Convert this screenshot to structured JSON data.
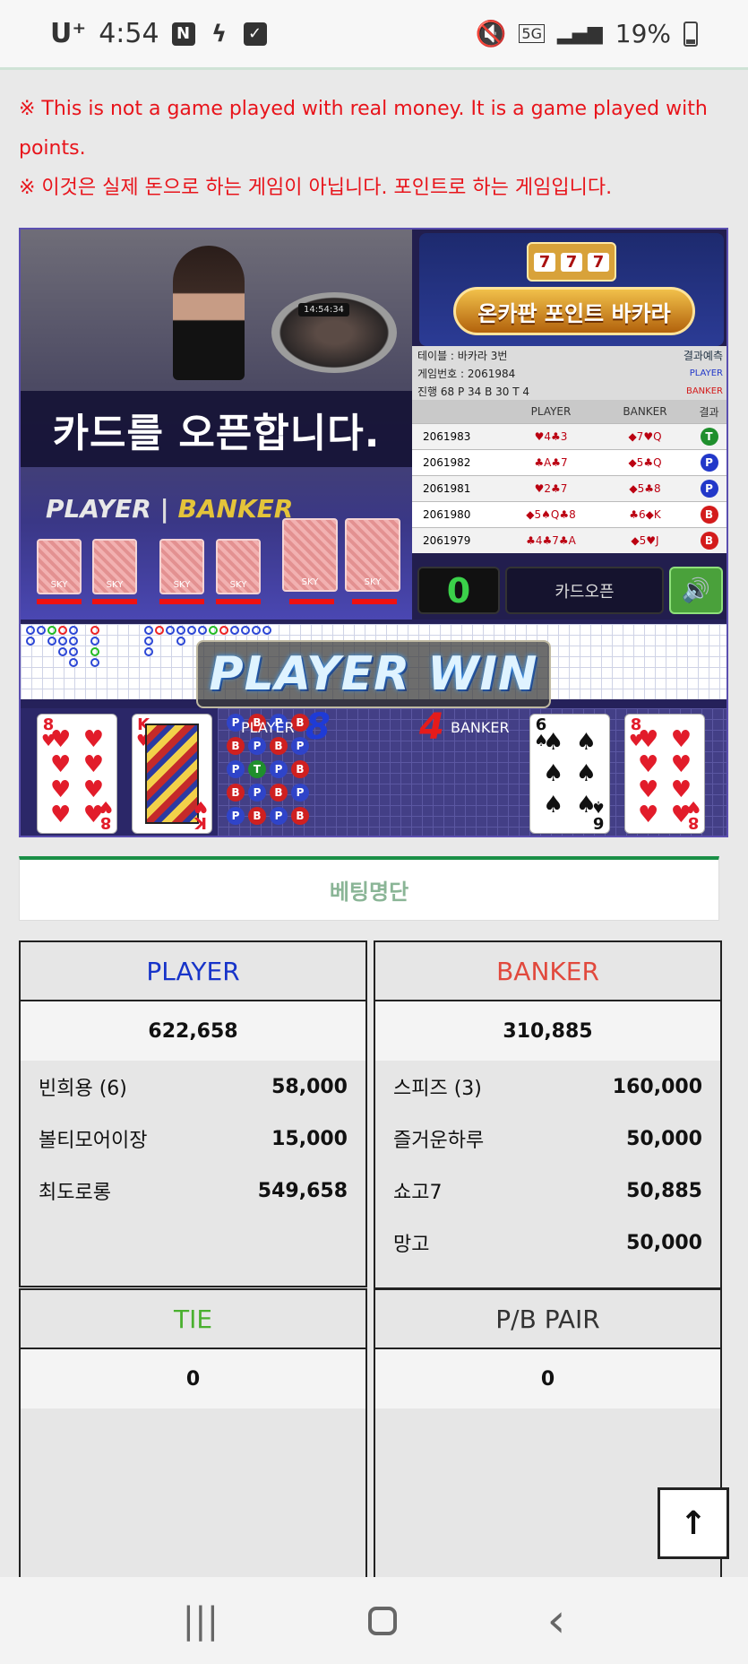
{
  "status_bar": {
    "carrier": "U⁺",
    "time": "4:54",
    "notif_icons": [
      "N",
      "✓"
    ],
    "network": "5G",
    "battery": "19%",
    "battery_level": 0.19
  },
  "notices": [
    "※ This is not a game played with real money. It is a game played with points.",
    "※ 이것은 실제 돈으로 하는 게임이 아닙니다. 포인트로 하는 게임입니다."
  ],
  "game": {
    "video_banner": "카드를 오픈합니다.",
    "clock": "14:54:34",
    "table_header": "PLAYER",
    "table_header_b": "BANKER",
    "shoe_card_text": "SKY",
    "logo_text": "온카판 포인트 바카라",
    "slot_digits": [
      "7",
      "7",
      "7"
    ],
    "info_table": "테이블 : 바카라 3번",
    "info_predict": "결과예측",
    "info_game_no": "게임번호 : 2061984",
    "info_player": "PLAYER",
    "info_stats": "진행 68  P 34  B 30  T 4",
    "info_banker": "BANKER",
    "results_headers": [
      "",
      "PLAYER",
      "BANKER",
      "결과"
    ],
    "results": [
      {
        "no": "2061983",
        "player": "♥4♣3",
        "banker": "◆7♥Q",
        "result": "T"
      },
      {
        "no": "2061982",
        "player": "♣A♣7",
        "banker": "◆5♣Q",
        "result": "P"
      },
      {
        "no": "2061981",
        "player": "♥2♣7",
        "banker": "◆5♣8",
        "result": "P"
      },
      {
        "no": "2061980",
        "player": "◆5♠Q♣8",
        "banker": "♣6◆K",
        "result": "B"
      },
      {
        "no": "2061979",
        "player": "♣4♣7♣A",
        "banker": "◆5♥J",
        "result": "B"
      }
    ],
    "count": "0",
    "open_button": "카드오픈",
    "sound_icon": "speaker-icon",
    "win_text": "PLAYER WIN",
    "player_label": "PLAYER",
    "player_score": "8",
    "banker_label": "BANKER",
    "banker_score": "4",
    "player_cards": [
      {
        "rank": "8",
        "suit": "♥",
        "color": "red"
      },
      {
        "rank": "K",
        "suit": "♥",
        "color": "red"
      }
    ],
    "banker_cards": [
      {
        "rank": "6",
        "suit": "♠",
        "color": "blk"
      },
      {
        "rank": "8",
        "suit": "♥",
        "color": "red"
      }
    ],
    "bubble_labels": [
      "P",
      "T",
      "B"
    ]
  },
  "betting": {
    "title": "베팅명단",
    "player": {
      "label": "PLAYER",
      "total": "622,658",
      "rows": [
        {
          "name": "빈희용 (6)",
          "amount": "58,000"
        },
        {
          "name": "볼티모어이장",
          "amount": "15,000"
        },
        {
          "name": "최도로롱",
          "amount": "549,658"
        }
      ]
    },
    "banker": {
      "label": "BANKER",
      "total": "310,885",
      "rows": [
        {
          "name": "스피즈 (3)",
          "amount": "160,000"
        },
        {
          "name": "즐거운하루",
          "amount": "50,000"
        },
        {
          "name": "쇼고7",
          "amount": "50,885"
        },
        {
          "name": "망고",
          "amount": "50,000"
        }
      ]
    },
    "tie": {
      "label": "TIE",
      "total": "0"
    },
    "pair": {
      "label": "P/B PAIR",
      "total": "0"
    }
  },
  "scroll_top_icon": "↑",
  "nav": {
    "recent": "|||",
    "back": "‹"
  }
}
